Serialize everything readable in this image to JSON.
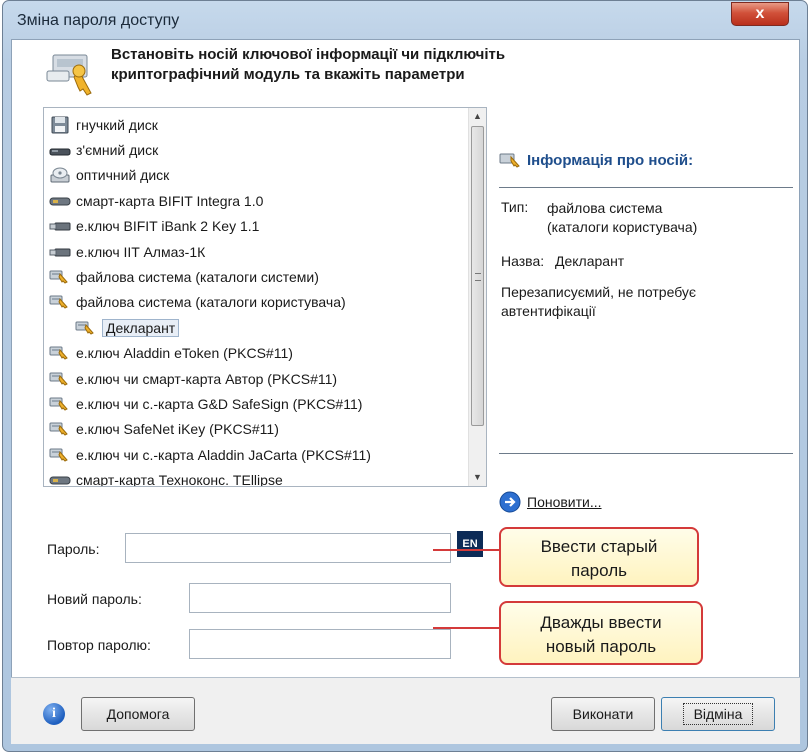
{
  "window": {
    "title": "Зміна пароля доступу",
    "close_glyph": "x"
  },
  "header": {
    "line1": "Встановіть носій ключової інформації чи підключіть",
    "line2": "криптографічний модуль та вкажіть параметри",
    "icon": "key-icon"
  },
  "media_list": {
    "items": [
      {
        "label": "гнучкий диск",
        "icon": "floppy-icon"
      },
      {
        "label": "з'ємний диск",
        "icon": "removable-disk-icon"
      },
      {
        "label": "оптичний диск",
        "icon": "optical-disk-icon"
      },
      {
        "label": "смарт-карта BIFIT Integra 1.0",
        "icon": "smartcard-icon"
      },
      {
        "label": "е.ключ BIFIT iBank 2 Key 1.1",
        "icon": "usb-key-icon"
      },
      {
        "label": "е.ключ IIT Алмаз-1К",
        "icon": "usb-key-icon"
      },
      {
        "label": "файлова система (каталоги системи)",
        "icon": "key-icon"
      },
      {
        "label": "файлова система (каталоги користувача)",
        "icon": "key-icon"
      },
      {
        "label": "Декларант",
        "icon": "key-icon",
        "selected": true,
        "indent": true
      },
      {
        "label": "е.ключ Aladdin eToken (PKCS#11)",
        "icon": "key-icon"
      },
      {
        "label": "е.ключ чи смарт-карта Автор (PKCS#11)",
        "icon": "key-icon"
      },
      {
        "label": "е.ключ чи с.-карта G&D SafeSign (PKCS#11)",
        "icon": "key-icon"
      },
      {
        "label": "е.ключ SafeNet iKey (PKCS#11)",
        "icon": "key-icon"
      },
      {
        "label": "е.ключ чи с.-карта Aladdin JaCarta (PKCS#11)",
        "icon": "key-icon"
      },
      {
        "label": "смарт-карта Техноконс. TEllipse",
        "icon": "smartcard-icon"
      }
    ]
  },
  "info": {
    "title": "Інформація про носій:",
    "type_label": "Тип:",
    "type_value_1": "файлова система",
    "type_value_2": "(каталоги користувача)",
    "name_label": "Назва:",
    "name_value": "Декларант",
    "note_1": "Перезаписуємий, не потребує",
    "note_2": "автентифікації",
    "refresh_label": "Поновити..."
  },
  "form": {
    "password_label": "Пароль:",
    "password_value": "",
    "lang_indicator": "EN",
    "new_password_label": "Новий пароль:",
    "new_password_value": "",
    "repeat_password_label": "Повтор паролю:",
    "repeat_password_value": ""
  },
  "callouts": {
    "old_line1": "Ввести старый",
    "old_line2": "пароль",
    "new_line1": "Дважды ввести",
    "new_line2": "новый пароль"
  },
  "footer": {
    "help_label": "Допомога",
    "execute_label": "Виконати",
    "cancel_label": "Відміна"
  },
  "colors": {
    "accent": "#1f4e8c",
    "callout_border": "#d43a3a",
    "callout_fill": "#fff6c8",
    "close_button": "#c8402a"
  }
}
